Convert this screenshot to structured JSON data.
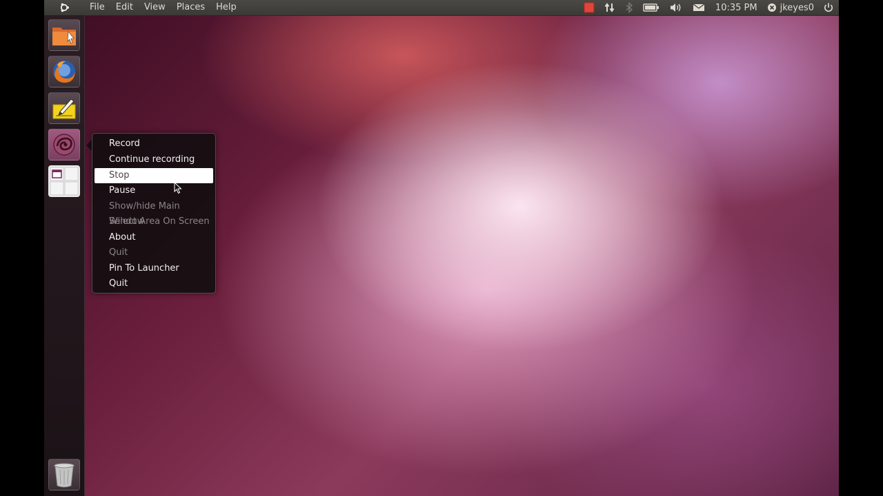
{
  "top_panel": {
    "menus": [
      "File",
      "Edit",
      "View",
      "Places",
      "Help"
    ],
    "clock": "10:35 PM",
    "user": "jkeyes0",
    "colors": {
      "record_indicator": "#e0443a"
    },
    "indicator_icons": [
      "record-indicator-icon",
      "network-icon",
      "bluetooth-icon",
      "battery-icon",
      "volume-icon",
      "mail-icon",
      "user-status-icon",
      "power-icon"
    ]
  },
  "launcher": {
    "items": [
      {
        "name": "home-folder",
        "icon": "folder-icon"
      },
      {
        "name": "firefox",
        "icon": "firefox-icon"
      },
      {
        "name": "text-editor",
        "icon": "notepad-icon"
      },
      {
        "name": "screen-recorder",
        "icon": "recorder-icon"
      },
      {
        "name": "workspace-switcher",
        "icon": "workspaces-icon"
      }
    ],
    "trash_icon": "trash-icon"
  },
  "quicklist": {
    "items": [
      {
        "label": "Record",
        "enabled": true
      },
      {
        "label": "Continue recording",
        "enabled": true
      },
      {
        "label": "Stop",
        "enabled": true,
        "highlighted": true
      },
      {
        "label": "Pause",
        "enabled": true
      },
      {
        "label": "Show/hide Main Window",
        "enabled": false
      },
      {
        "label": "Select Area On Screen",
        "enabled": false
      },
      {
        "label": "About",
        "enabled": true
      },
      {
        "label": "Quit",
        "enabled": false
      },
      {
        "label": "Pin To Launcher",
        "enabled": true
      },
      {
        "label": "Quit",
        "enabled": true
      }
    ]
  }
}
